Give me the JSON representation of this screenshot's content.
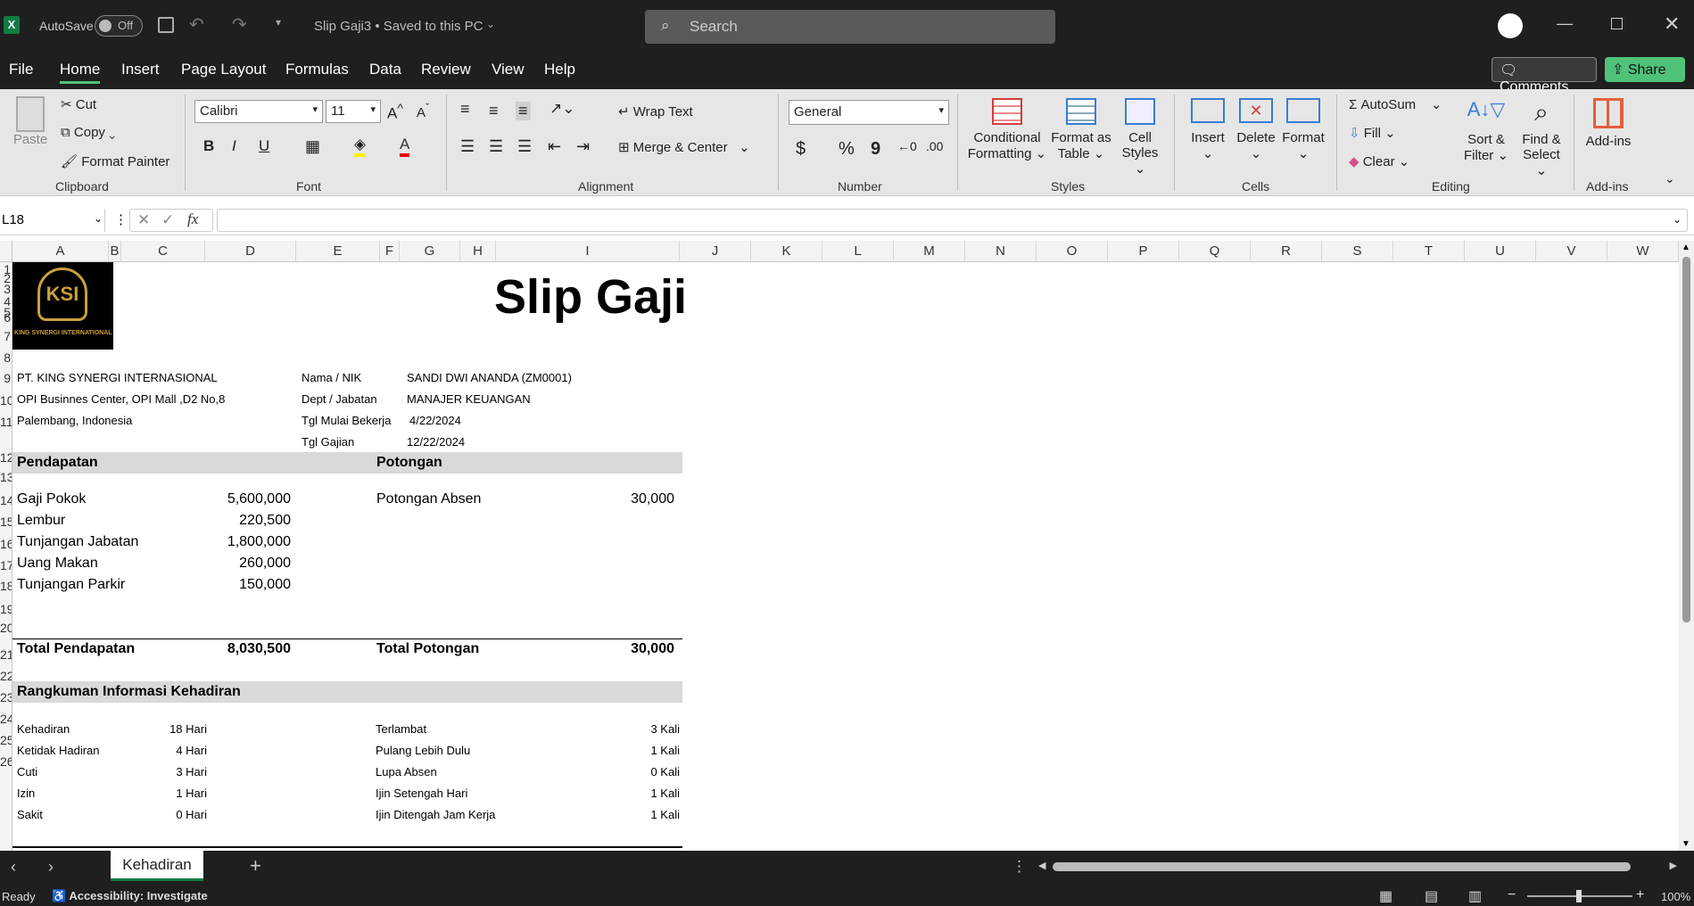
{
  "titlebar": {
    "app_icon": "excel-icon",
    "autosave_label": "AutoSave",
    "autosave_state": "Off",
    "doc_title": "Slip Gaji3 • Saved to this PC",
    "search_placeholder": "Search"
  },
  "menu": {
    "tabs": [
      "File",
      "Home",
      "Insert",
      "Page Layout",
      "Formulas",
      "Data",
      "Review",
      "View",
      "Help"
    ],
    "active": "Home",
    "comments": "Comments",
    "share": "Share"
  },
  "ribbon": {
    "clipboard": {
      "paste": "Paste",
      "cut": "Cut",
      "copy": "Copy",
      "format_painter": "Format Painter",
      "label": "Clipboard"
    },
    "font": {
      "name": "Calibri",
      "size": "11",
      "bold": "B",
      "italic": "I",
      "underline": "U",
      "label": "Font"
    },
    "alignment": {
      "wrap": "Wrap Text",
      "merge": "Merge & Center",
      "label": "Alignment"
    },
    "number": {
      "format": "General",
      "currency": "$",
      "percent": "%",
      "comma": "9",
      "label": "Number"
    },
    "styles": {
      "conditional": "Conditional",
      "conditional2": "Formatting",
      "format_table": "Format as",
      "format_table2": "Table",
      "cell_styles": "Cell",
      "cell_styles2": "Styles",
      "label": "Styles"
    },
    "cells": {
      "insert": "Insert",
      "delete": "Delete",
      "format": "Format",
      "label": "Cells"
    },
    "editing": {
      "autosum": "AutoSum",
      "fill": "Fill",
      "clear": "Clear",
      "sort": "Sort &",
      "sort2": "Filter",
      "find": "Find &",
      "find2": "Select",
      "label": "Editing"
    },
    "addins": {
      "addins": "Add-ins",
      "label": "Add-ins"
    }
  },
  "formula_bar": {
    "name_box": "L18",
    "fx": "fx",
    "value": ""
  },
  "columns": [
    "A",
    "B",
    "C",
    "D",
    "E",
    "F",
    "G",
    "H",
    "I",
    "J",
    "K",
    "L",
    "M",
    "N",
    "O",
    "P",
    "Q",
    "R",
    "S",
    "T",
    "U",
    "V",
    "W"
  ],
  "rows": [
    "1",
    "2",
    "3",
    "4",
    "5",
    "6",
    "7",
    "8",
    "9",
    "10",
    "11",
    "12",
    "13",
    "14",
    "15",
    "16",
    "17",
    "18",
    "19",
    "20",
    "21",
    "22",
    "23",
    "24",
    "25",
    "26"
  ],
  "slip": {
    "title": "Slip Gaji",
    "logo_text": "KING SYNERGI INTERNATIONAL",
    "company": [
      "PT. KING SYNERGI INTERNASIONAL",
      "OPI Businnes Center, OPI Mall ,D2 No,8",
      "Palembang, Indonesia"
    ],
    "info_labels": [
      "Nama / NIK",
      "Dept / Jabatan",
      "Tgl Mulai Bekerja",
      "Tgl Gajian"
    ],
    "info_values": [
      "SANDI DWI ANANDA (ZM0001)",
      "MANAJER KEUANGAN",
      "4/22/2024",
      "12/22/2024"
    ],
    "pendapatan_hdr": "Pendapatan",
    "potongan_hdr": "Potongan",
    "pendapatan": [
      {
        "label": "Gaji Pokok",
        "value": "5,600,000"
      },
      {
        "label": "Lembur",
        "value": "220,500"
      },
      {
        "label": "Tunjangan Jabatan",
        "value": "1,800,000"
      },
      {
        "label": "Uang Makan",
        "value": "260,000"
      },
      {
        "label": "Tunjangan Parkir",
        "value": "150,000"
      }
    ],
    "potongan": [
      {
        "label": "Potongan Absen",
        "value": "30,000"
      }
    ],
    "total_pendapatan_label": "Total Pendapatan",
    "total_pendapatan": "8,030,500",
    "total_potongan_label": "Total Potongan",
    "total_potongan": "30,000",
    "rangkuman_hdr": "Rangkuman  Informasi Kehadiran",
    "kehadiran": [
      {
        "label": "Kehadiran",
        "value": "18 Hari"
      },
      {
        "label": "Ketidak Hadiran",
        "value": "4 Hari"
      },
      {
        "label": "Cuti",
        "value": "3 Hari"
      },
      {
        "label": "Izin",
        "value": "1 Hari"
      },
      {
        "label": "Sakit",
        "value": "0 Hari"
      }
    ],
    "lainnya": [
      {
        "label": "Terlambat",
        "value": "3 Kali"
      },
      {
        "label": "Pulang Lebih Dulu",
        "value": "1 Kali"
      },
      {
        "label": "Lupa Absen",
        "value": "0 Kali"
      },
      {
        "label": "Ijin Setengah Hari",
        "value": "1 Kali"
      },
      {
        "label": "Ijin Ditengah Jam Kerja",
        "value": "1 Kali"
      }
    ]
  },
  "sheet_tab": "Kehadiran",
  "status": {
    "ready": "Ready",
    "accessibility": "Accessibility: Investigate",
    "zoom": "100%"
  }
}
